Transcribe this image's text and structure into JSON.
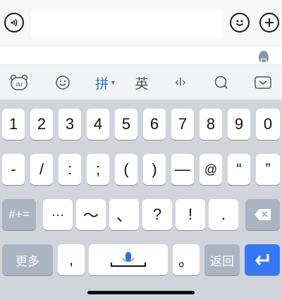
{
  "chat": {
    "voice_icon": "voice-wave-icon",
    "emoji_icon": "smiley-icon",
    "plus_icon": "plus-icon",
    "input_value": ""
  },
  "toolbar": {
    "du_label": "du",
    "pinyin_label": "拼",
    "english_label": "英",
    "cursor_label": "‹I›"
  },
  "keys": {
    "row1": [
      "1",
      "2",
      "3",
      "4",
      "5",
      "6",
      "7",
      "8",
      "9",
      "0"
    ],
    "row2": [
      "-",
      "/",
      ":",
      ";",
      "(",
      ")",
      "—",
      "@",
      "“",
      "”"
    ],
    "row3": [
      "···",
      "〜",
      "、",
      "?",
      "!",
      "."
    ],
    "symbols_label": "#+=",
    "more_label": "更多",
    "comma_label": ",",
    "period_label": "。",
    "back_label": "返回"
  },
  "colors": {
    "accent": "#3478f6",
    "active_tab": "#2a73d9",
    "function_key": "#aab4c3",
    "keyboard_bg": "#d1d5db"
  }
}
